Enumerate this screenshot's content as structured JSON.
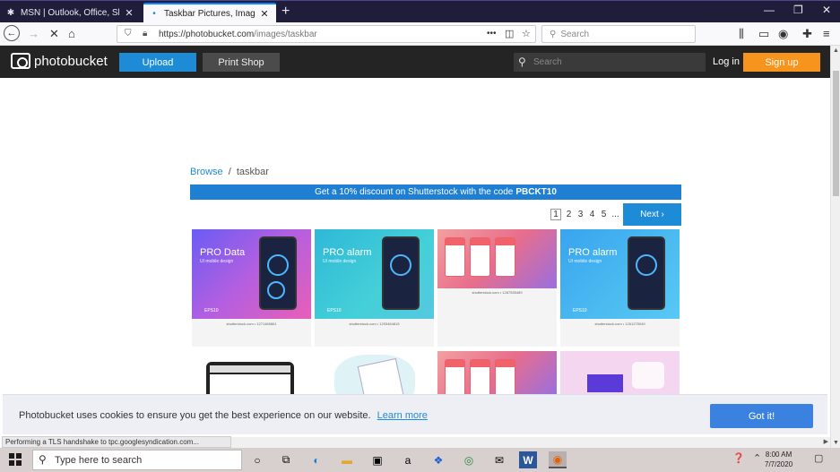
{
  "browser": {
    "tabs": [
      {
        "title": "MSN | Outlook, Office, Skype, B",
        "active": false,
        "favicon": "msn-icon"
      },
      {
        "title": "Taskbar Pictures, Images & Pho",
        "active": true,
        "favicon": "photobucket-icon"
      }
    ],
    "url_prefix": "https://photobucket.com",
    "url_path": "/images/taskbar",
    "search_placeholder": "Search"
  },
  "site": {
    "logo_text": "photobucket",
    "upload_label": "Upload",
    "printshop_label": "Print Shop",
    "search_placeholder": "Search",
    "login_label": "Log in",
    "signup_label": "Sign up"
  },
  "content": {
    "breadcrumb_link": "Browse",
    "breadcrumb_sep": "/",
    "breadcrumb_current": "taskbar",
    "promo_text": "Get a 10% discount on Shutterstock with the code",
    "promo_code": "PBCKT10",
    "pages": [
      "1",
      "2",
      "3",
      "4",
      "5",
      "..."
    ],
    "next_label": "Next ›",
    "thumbs": [
      {
        "title": "PRO Data",
        "subtitle": "UI mobile design",
        "badge": "EPS10",
        "caption": "shutterstock.com • 1271465861"
      },
      {
        "title": "PRO alarm",
        "subtitle": "UI mobile design",
        "badge": "EPS10",
        "caption": "shutterstock.com • 1293464815"
      },
      {
        "title": "",
        "subtitle": "",
        "badge": "",
        "caption": "shutterstock.com • 1287535489"
      },
      {
        "title": "PRO alarm",
        "subtitle": "UI mobile design",
        "badge": "EPS10",
        "caption": "shutterstock.com • 1261275049"
      }
    ]
  },
  "cookie": {
    "message": "Photobucket uses cookies to ensure you get the best experience on our website.",
    "learn_more": "Learn more",
    "accept_label": "Got it!"
  },
  "status_text": "Performing a TLS handshake to tpc.googlesyndication.com...",
  "taskbar": {
    "search_placeholder": "Type here to search",
    "time": "8:00 AM",
    "date": "7/7/2020"
  },
  "colors": {
    "accent_blue": "#1e8bd6",
    "signup_orange": "#f7941d",
    "header_dark": "#242424"
  }
}
